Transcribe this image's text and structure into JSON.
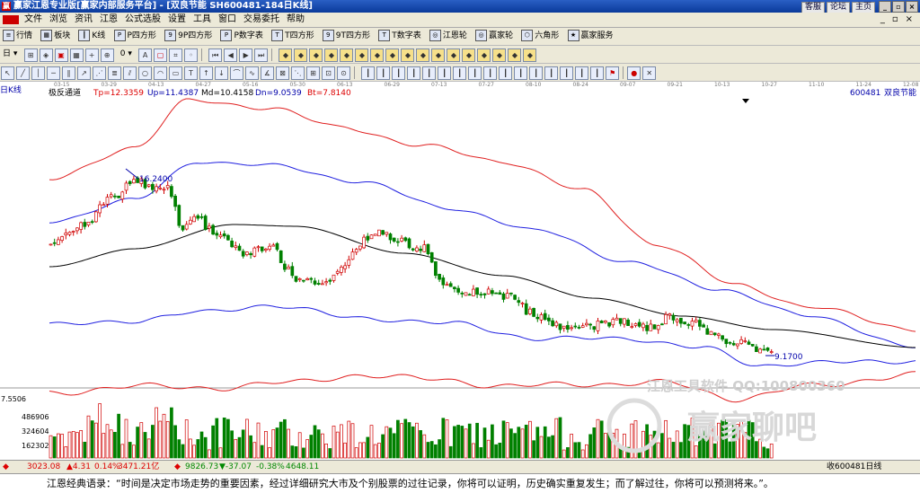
{
  "window": {
    "title": "赢家江恩专业版[赢家内部服务平台] - [双良节能  SH600481-184日K线]",
    "title_links": [
      "客服",
      "论坛",
      "主页"
    ]
  },
  "menu": {
    "items": [
      "文件",
      "浏览",
      "资讯",
      "江恩",
      "公式选股",
      "设置",
      "工具",
      "窗口",
      "交易委托",
      "帮助"
    ]
  },
  "toolbar1": {
    "items": [
      "行情",
      "板块",
      "K线",
      "P四方形",
      "9P四方形",
      "P数字表",
      "T四方形",
      "9T四方形",
      "T数字表",
      "江恩轮",
      "赢家轮",
      "六角形",
      "赢家服务"
    ]
  },
  "chart_header": {
    "period_label": "日K线",
    "indicator_name": "极反通道",
    "tp": "Tp=12.3359",
    "up": "Up=11.4387",
    "md": "Md=10.4158",
    "dn": "Dn=9.0539",
    "bt": "Bt=7.8140",
    "stock_code": "600481",
    "stock_name": "双良节能"
  },
  "date_axis": {
    "labels": [
      "03-15",
      "03-29",
      "04-13",
      "04-27",
      "05-16",
      "05-30",
      "06-13",
      "06-29",
      "07-13",
      "07-27",
      "08-10",
      "08-24",
      "09-07",
      "09-21",
      "10-13",
      "10-27",
      "11-10",
      "11-24",
      "12-08"
    ]
  },
  "annotations": {
    "high": "16.2400",
    "low": "9.1700"
  },
  "volume_axis": {
    "top_label": "7.5506",
    "labels": [
      "486906",
      "324604",
      "162302"
    ]
  },
  "watermark": {
    "line1": "江恩工具软件  QQ:100800360",
    "line2": "赢家聊吧"
  },
  "status": {
    "sh_index": "3023.08",
    "sh_change": "▲4.31",
    "sh_pct": "0.14%",
    "sh_amount": "3471.21亿",
    "sz_index": "9826.73",
    "sz_change": "▼-37.07",
    "sz_pct": "-0.38%",
    "sz_amount": "4648.11",
    "right_label": "收600481日线"
  },
  "quote": {
    "text": "江恩经典语录：“时间是决定市场走势的重要因素，经过详细研究大市及个别股票的过往记录，你将可以证明，历史确实重复发生；而了解过往，你将可以预测将来。”。"
  },
  "colors": {
    "up": "#d00000",
    "down": "#008000",
    "outer_band": "#e02020",
    "inner_band": "#2020e0",
    "mid_line": "#000000"
  }
}
